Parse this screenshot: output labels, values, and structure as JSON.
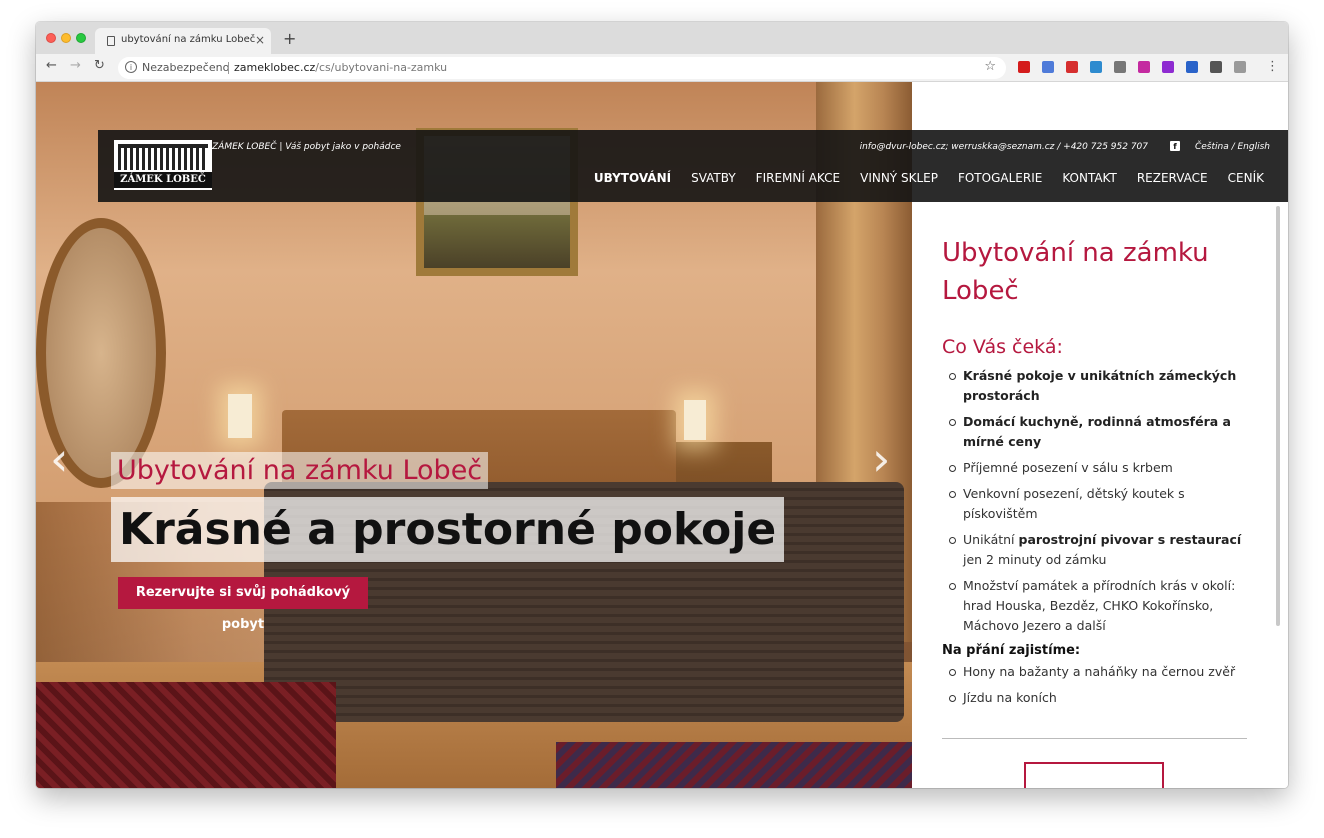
{
  "browser": {
    "tab_title": "ubytování na zámku Lobeč",
    "new_tab": "+",
    "tab_close": "×",
    "insecure_label": "Nezabezpečeno",
    "url_host": "zameklobec.cz",
    "url_path": "/cs/ubytovani-na-zamku",
    "back": "←",
    "forward": "→",
    "reload": "↻",
    "star": "☆",
    "menu": "⋮",
    "extension_colors": [
      "#d41c1c",
      "#4f7bd9",
      "#d62f2f",
      "#2e8bcf",
      "#777777",
      "#c42aa0",
      "#8e2bd1",
      "#2a63c9",
      "#555555",
      "#9a9a9a"
    ]
  },
  "header": {
    "logo_text": "ZÁMEK LOBEČ",
    "tagline": "ZÁMEK LOBEČ  |  Váš pobyt jako v pohádce",
    "contact": "info@dvur-lobec.cz; werruskka@seznam.cz / +420 725 952 707",
    "facebook": "f",
    "languages": "Čeština / English",
    "menu": [
      {
        "label": "UBYTOVÁNÍ",
        "active": true
      },
      {
        "label": "SVATBY"
      },
      {
        "label": "FIREMNÍ AKCE"
      },
      {
        "label": "VINNÝ SKLEP"
      },
      {
        "label": "FOTOGALERIE"
      },
      {
        "label": "KONTAKT"
      },
      {
        "label": "REZERVACE"
      },
      {
        "label": "CENÍK"
      }
    ]
  },
  "hero": {
    "subtitle": "Ubytování na zámku Lobeč",
    "title": "Krásné a prostorné pokoje",
    "cta": "Rezervujte si svůj pohádkový pobyt",
    "prev_arrow": "‹",
    "next_arrow": "›"
  },
  "panel": {
    "title": "Ubytování na zámku Lobeč",
    "what_awaits": "Co Vás čeká:",
    "items": [
      {
        "bold": "Krásné pokoje v unikátních zámeckých prostorách",
        "text": ""
      },
      {
        "bold": "Domácí kuchyně, rodinná atmosféra a mírné ceny",
        "text": ""
      },
      {
        "bold": "",
        "text": "Příjemné posezení v sálu s krbem"
      },
      {
        "bold": "",
        "text": "Venkovní posezení, dětský koutek s pískovištěm"
      },
      {
        "pre": "Unikátní ",
        "bold": "parostrojní pivovar s restaurací",
        "text": " jen 2 minuty od zámku"
      },
      {
        "bold": "",
        "text": "Množství památek a přírodních krás v okolí: hrad Houska, Bezděz, CHKO Kokořínsko, Máchovo Jezero a další"
      }
    ],
    "on_request": "Na přání zajistíme:",
    "request_items": [
      "Hony na bažanty a naháňky na černou zvěř",
      "Jízdu na koních"
    ]
  }
}
